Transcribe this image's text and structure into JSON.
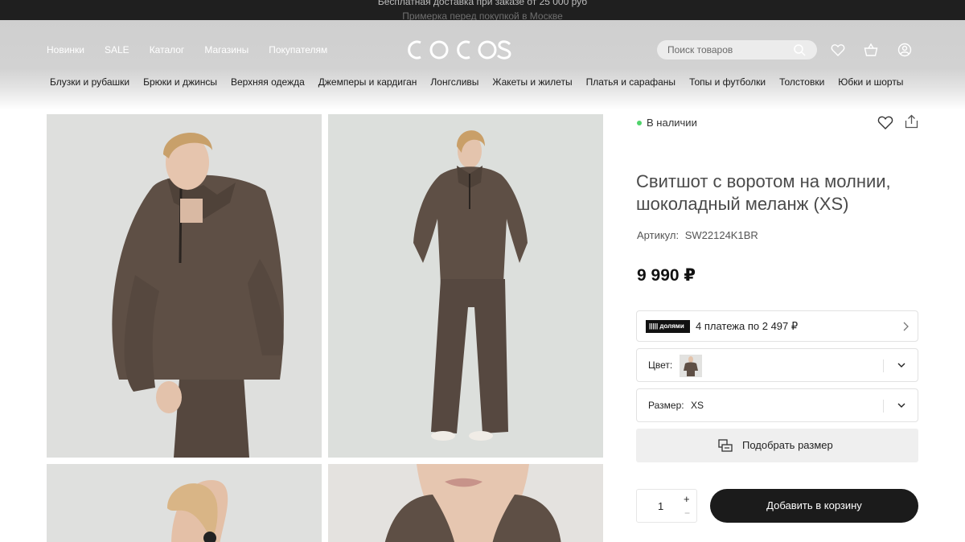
{
  "announcement": {
    "line1": "Бесплатная доставка при заказе от 25 000 руб",
    "line2": "Примерка перед покупкой в Москве"
  },
  "header": {
    "logo_text": "COCOS",
    "topnav": [
      "Новинки",
      "SALE",
      "Каталог",
      "Магазины",
      "Покупателям"
    ],
    "search_placeholder": "Поиск товаров",
    "icons": [
      "search-icon",
      "heart-icon",
      "basket-icon",
      "user-icon"
    ]
  },
  "catnav": [
    "Блузки и рубашки",
    "Брюки и джинсы",
    "Верхняя одежда",
    "Джемперы и кардиган",
    "Лонгсливы",
    "Жакеты и жилеты",
    "Платья и сарафаны",
    "Топы и футболки",
    "Толстовки",
    "Юбки и шорты"
  ],
  "gallery": {
    "count": 4,
    "background": "#dfe0de",
    "garment_color": "#5e4f45"
  },
  "product": {
    "stock": "В наличии",
    "stock_color": "#4fd36b",
    "title": "Свитшот с воротом на молнии, шоколадный меланж (XS)",
    "sku_label": "Артикул:",
    "sku": "SW22124K1BR",
    "price": "9 990 ₽",
    "dolyami_badge": "||||| долями",
    "installments": "4 платежа по 2 497 ₽",
    "color_label": "Цвет:",
    "size_label": "Размер:",
    "size_value": "XS",
    "fit_label": "Подобрать размер",
    "qty": "1",
    "plus": "+",
    "minus": "−",
    "add_to_cart": "Добавить в корзину"
  }
}
